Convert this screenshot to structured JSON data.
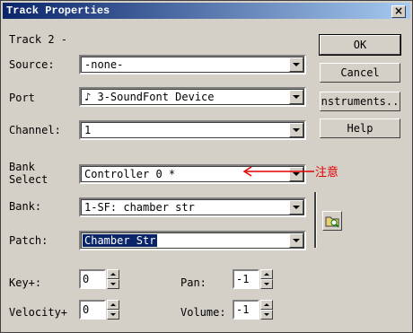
{
  "window": {
    "title": "Track Properties",
    "close_symbol": "×"
  },
  "track_label": "Track 2 -",
  "fields": {
    "source": {
      "label": "Source:",
      "accel": "S",
      "value": "-none-"
    },
    "port": {
      "label": "Port",
      "accel": "t",
      "value": "♪ 3-SoundFont Device"
    },
    "channel": {
      "label": "Channel:",
      "accel": "C",
      "value": "1"
    },
    "bank_select": {
      "label_line1": "Bank",
      "label_line2": "Select",
      "value": "Controller 0   *"
    },
    "bank": {
      "label": "Bank:",
      "accel": "B",
      "value": "1-SF: chamber str"
    },
    "patch": {
      "label": "Patch:",
      "accel": "P",
      "value": "Chamber Str"
    }
  },
  "spinners": {
    "key": {
      "label": "Key+:",
      "value": "0"
    },
    "velocity": {
      "label": "Velocity+",
      "value": "0"
    },
    "pan": {
      "label": "Pan:",
      "value": "-1"
    },
    "volume": {
      "label": "Volume:",
      "value": "-1"
    }
  },
  "buttons": {
    "ok": "OK",
    "cancel": "Cancel",
    "instruments": "nstruments..",
    "help": "Help"
  },
  "annotation": {
    "arrow": "←",
    "text": "注意",
    "color": "#e00000"
  },
  "icons": {
    "bank_patch_browse": "folder-icon"
  }
}
